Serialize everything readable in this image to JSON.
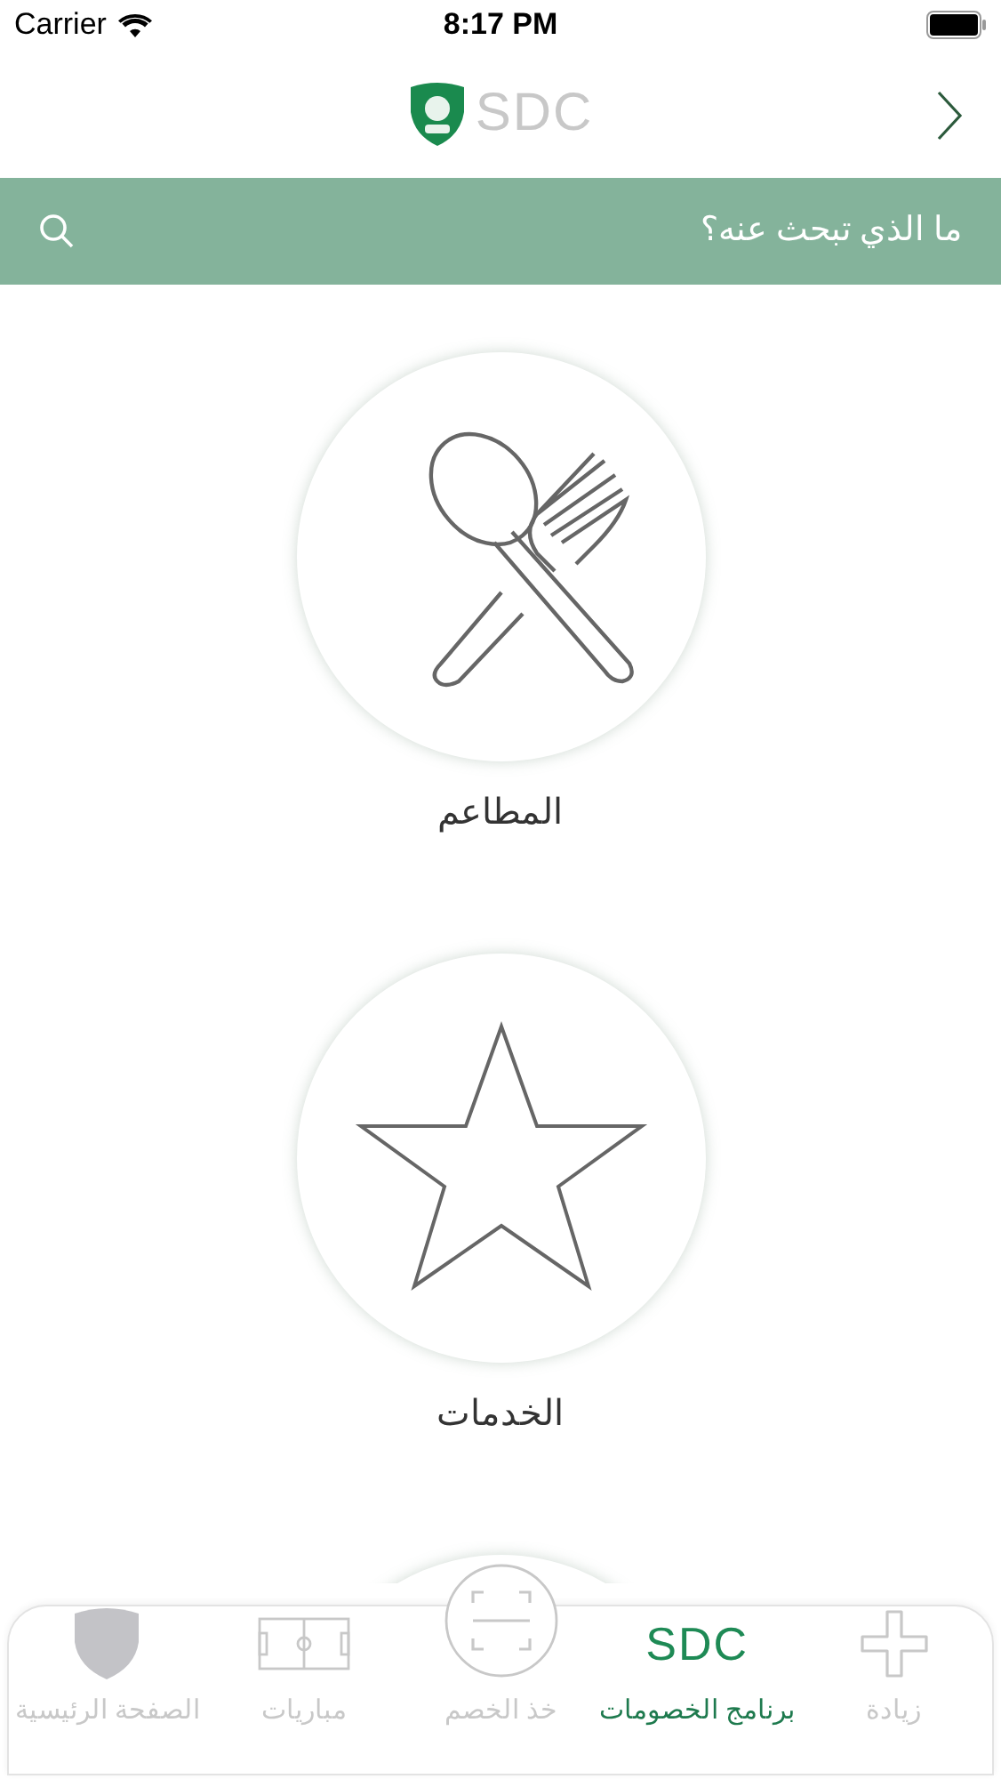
{
  "status_bar": {
    "carrier": "Carrier",
    "time": "8:17 PM"
  },
  "header": {
    "logo_text": "SDC"
  },
  "search": {
    "placeholder": "ما الذي تبحث عنه؟"
  },
  "categories": [
    {
      "label": "المطاعم",
      "kind": "restaurant"
    },
    {
      "label": "الخدمات",
      "kind": "star"
    }
  ],
  "tab_bar": [
    {
      "label": "زيادة",
      "kind": "plus",
      "selected": false
    },
    {
      "label": "برنامج الخصومات",
      "kind": "logo",
      "icon_text": "SDC",
      "selected": true
    },
    {
      "label": "خذ الخصم",
      "kind": "scan",
      "selected": false
    },
    {
      "label": "مباريات",
      "kind": "pitch",
      "selected": false
    },
    {
      "label": "الصفحة الرئيسية",
      "kind": "shield",
      "selected": false
    }
  ]
}
